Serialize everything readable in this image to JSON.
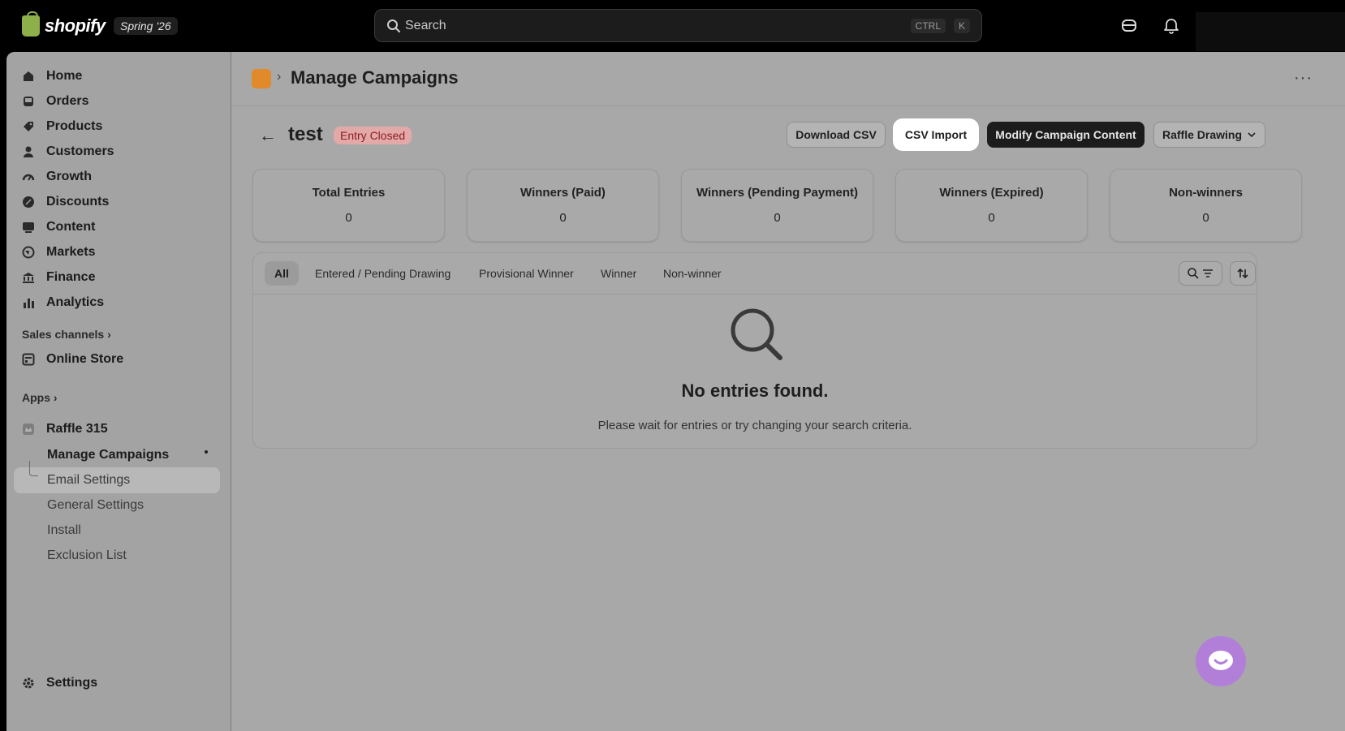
{
  "topbar": {
    "brand": "shopify",
    "edition": "Spring '26",
    "search_placeholder": "Search",
    "shortcut_ctrl": "CTRL",
    "shortcut_k": "K"
  },
  "sidebar": {
    "items": [
      {
        "label": "Home",
        "icon": "home-icon"
      },
      {
        "label": "Orders",
        "icon": "inbox-icon"
      },
      {
        "label": "Products",
        "icon": "tag-icon"
      },
      {
        "label": "Customers",
        "icon": "person-icon"
      },
      {
        "label": "Growth",
        "icon": "gauge-icon"
      },
      {
        "label": "Discounts",
        "icon": "discount-icon"
      },
      {
        "label": "Content",
        "icon": "content-icon"
      },
      {
        "label": "Markets",
        "icon": "globe-icon"
      },
      {
        "label": "Finance",
        "icon": "bank-icon"
      },
      {
        "label": "Analytics",
        "icon": "bar-chart-icon"
      }
    ],
    "sales_channels_label": "Sales channels",
    "online_store_label": "Online Store",
    "apps_label": "Apps",
    "app_name": "Raffle 315",
    "app_subitems": [
      "Manage Campaigns",
      "Email Settings",
      "General Settings",
      "Install",
      "Exclusion List"
    ],
    "settings_label": "Settings"
  },
  "header": {
    "title": "Manage Campaigns",
    "separator": "›",
    "more": "···"
  },
  "campaign": {
    "back": "←",
    "name": "test",
    "status": "Entry Closed"
  },
  "actions": {
    "download_csv": "Download CSV",
    "csv_import": "CSV Import",
    "modify_content": "Modify Campaign Content",
    "raffle_drawing": "Raffle Drawing"
  },
  "stats": [
    {
      "label": "Total Entries",
      "value": "0"
    },
    {
      "label": "Winners (Paid)",
      "value": "0"
    },
    {
      "label": "Winners (Pending Payment)",
      "value": "0"
    },
    {
      "label": "Winners (Expired)",
      "value": "0"
    },
    {
      "label": "Non-winners",
      "value": "0"
    }
  ],
  "tabs": [
    "All",
    "Entered / Pending Drawing",
    "Provisional Winner",
    "Winner",
    "Non-winner"
  ],
  "empty": {
    "title": "No entries found.",
    "subtitle": "Please wait for entries or try changing your search criteria."
  },
  "colors": {
    "badge_bg": "#e3a9a9",
    "badge_text": "#8a1c1c",
    "primary_button": "#1c1c1c",
    "chat_bubble": "#b27fd8"
  }
}
